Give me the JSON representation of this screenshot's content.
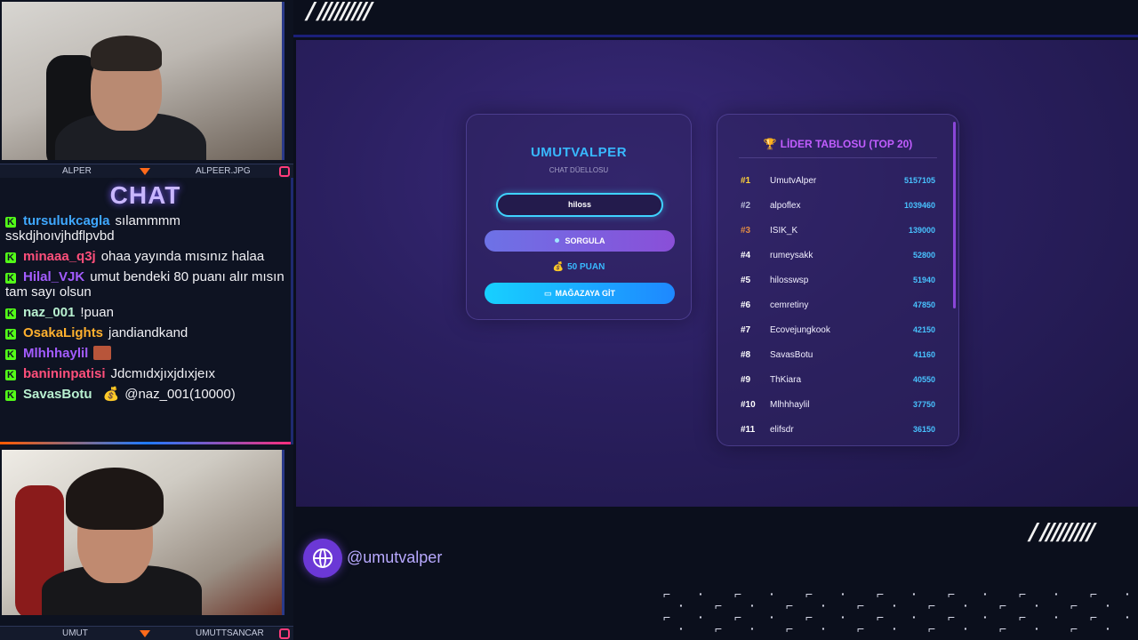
{
  "webcam_top": {
    "name_left": "ALPER",
    "name_right": "ALPEER.JPG"
  },
  "webcam_bottom": {
    "name_left": "UMUT",
    "name_right": "UMUTTSANCAR"
  },
  "chat": {
    "title": "CHAT",
    "messages": [
      {
        "user": "tursulukcagla",
        "text": "sılammmm sskdjhoıvjhdflpvbd",
        "color": "#3fa8ff"
      },
      {
        "user": "minaaa_q3j",
        "text": "ohaa yayında mısınız halaa",
        "color": "#ff4f7b"
      },
      {
        "user": "Hilal_VJK",
        "text": "umut bendeki 80 puanı alır mısın tam sayı olsun",
        "color": "#a35cff"
      },
      {
        "user": "naz_001",
        "text": "!puan",
        "color": "#b8f0d0"
      },
      {
        "user": "OsakaLights",
        "text": "jandiandkand",
        "color": "#ffb02e"
      },
      {
        "user": "Mlhhhaylil",
        "text": "",
        "color": "#a35cff"
      },
      {
        "user": "banininpatisi",
        "text": "Jdcmıdxjıxjdıxjeıx",
        "color": "#ff4f7b"
      },
      {
        "user": "SavasBotu",
        "text": "@naz_001(10000)",
        "color": "#b8f0d0"
      }
    ]
  },
  "duel_card": {
    "title": "UMUTVALPER",
    "subtitle": "CHAT DÜELLOSU",
    "input_value": "hiloss",
    "query_button": "SORGULA",
    "points": "50 PUAN",
    "store_button": "MAĞAZAYA GİT"
  },
  "leaderboard": {
    "title": "LİDER TABLOSU (TOP 20)",
    "rows": [
      {
        "rank": "#1",
        "name": "UmutvAlper",
        "score": "5157105"
      },
      {
        "rank": "#2",
        "name": "alpoflex",
        "score": "1039460"
      },
      {
        "rank": "#3",
        "name": "ISIK_K",
        "score": "139000"
      },
      {
        "rank": "#4",
        "name": "rumeysakk",
        "score": "52800"
      },
      {
        "rank": "#5",
        "name": "hilosswsp",
        "score": "51940"
      },
      {
        "rank": "#6",
        "name": "cemretiny",
        "score": "47850"
      },
      {
        "rank": "#7",
        "name": "Ecovejungkook",
        "score": "42150"
      },
      {
        "rank": "#8",
        "name": "SavasBotu",
        "score": "41160"
      },
      {
        "rank": "#9",
        "name": "ThKiara",
        "score": "40550"
      },
      {
        "rank": "#10",
        "name": "Mlhhhaylil",
        "score": "37750"
      },
      {
        "rank": "#11",
        "name": "elifsdr",
        "score": "36150"
      }
    ]
  },
  "footer": {
    "handle": "@umutvalper"
  },
  "colors": {
    "accent_blue": "#38b9ff",
    "accent_purple": "#c15dff",
    "kick_green": "#53fc18"
  }
}
